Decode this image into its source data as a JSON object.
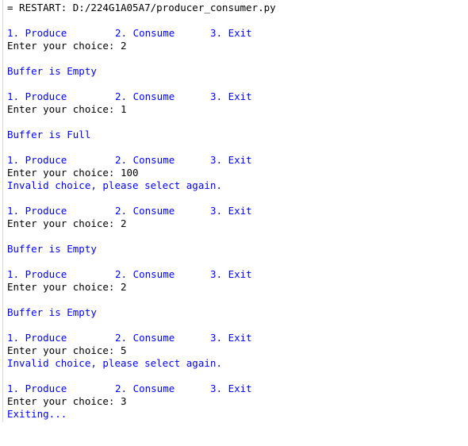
{
  "restart_line": "= RESTART: D:/224G1A05A7/producer_consumer.py",
  "menu": {
    "produce": "1. Produce",
    "consume": "2. Consume",
    "exit": "3. Exit"
  },
  "prompt_lines": [
    "Enter your choice: 2",
    "Enter your choice: 1",
    "Enter your choice: 100",
    "Enter your choice: 2",
    "Enter your choice: 2",
    "Enter your choice: 5",
    "Enter your choice: 3"
  ],
  "output_lines": [
    "Buffer is Empty",
    "Buffer is Full",
    "Invalid choice, please select again.",
    "Buffer is Empty",
    "Buffer is Empty",
    "Invalid choice, please select again.",
    "Exiting..."
  ],
  "colors": {
    "input_text": "#000000",
    "output_text": "#0000ff"
  }
}
